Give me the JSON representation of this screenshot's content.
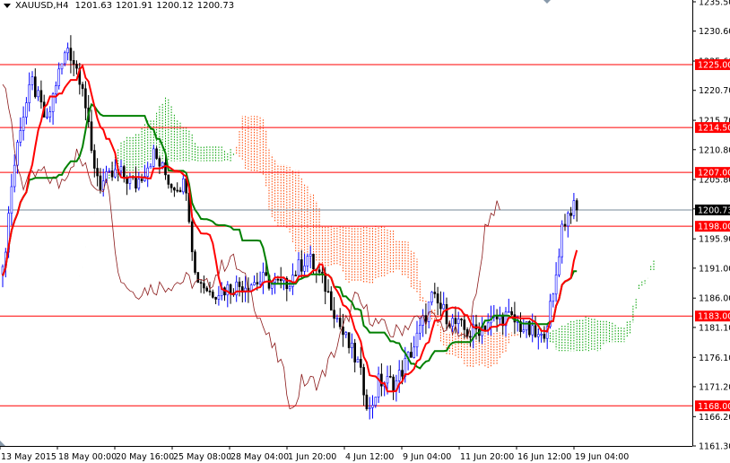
{
  "header": {
    "symbol": "XAUUSD,H4",
    "open": "1201.63",
    "high": "1201.91",
    "low": "1200.12",
    "close": "1200.73"
  },
  "colors": {
    "bull": "#0000ff",
    "bear": "#000000",
    "level": "#ff0000",
    "tenkan": "#ff0000",
    "kijun": "#008000",
    "chikou": "#8b1a1a",
    "cloud_up": "#00a000",
    "cloud_down": "#ff4500",
    "price_line": "#778899"
  },
  "chart_data": {
    "type": "candlestick",
    "symbol": "XAUUSD",
    "timeframe": "H4",
    "ylim": [
      1161.3,
      1235.5
    ],
    "y_ticks": [
      "1235.50",
      "1230.60",
      "1225.60",
      "1220.70",
      "1215.70",
      "1210.80",
      "1205.80",
      "1200.90",
      "1195.90",
      "1191.00",
      "1186.00",
      "1181.10",
      "1176.10",
      "1171.20",
      "1166.20",
      "1161.30"
    ],
    "x_ticks": [
      "13 May 2015",
      "18 May 00:00",
      "20 May 16:00",
      "25 May 08:00",
      "28 May 04:00",
      "1 Jun 20:00",
      "4 Jun 12:00",
      "9 Jun 04:00",
      "11 Jun 20:00",
      "16 Jun 12:00",
      "19 Jun 04:00"
    ],
    "levels": [
      {
        "value": 1225.0,
        "label": "1225.00"
      },
      {
        "value": 1214.5,
        "label": "1214.50"
      },
      {
        "value": 1207.0,
        "label": "1207.00"
      },
      {
        "value": 1198.0,
        "label": "1198.00"
      },
      {
        "value": 1183.0,
        "label": "1183.00"
      },
      {
        "value": 1168.0,
        "label": "1168.00"
      }
    ],
    "current_price": {
      "value": 1200.73,
      "label": "1200.73"
    },
    "indicator": "Ichimoku (9,26,52)",
    "price_path": [
      [
        0,
        1190
      ],
      [
        3,
        1205
      ],
      [
        6,
        1215
      ],
      [
        10,
        1222
      ],
      [
        15,
        1215
      ],
      [
        18,
        1222
      ],
      [
        22,
        1228
      ],
      [
        27,
        1222
      ],
      [
        30,
        1210
      ],
      [
        33,
        1205
      ],
      [
        39,
        1207
      ],
      [
        45,
        1205
      ],
      [
        51,
        1210
      ],
      [
        57,
        1205
      ],
      [
        62,
        1205
      ],
      [
        65,
        1190
      ],
      [
        70,
        1187
      ],
      [
        79,
        1188
      ],
      [
        88,
        1189
      ],
      [
        95,
        1188
      ],
      [
        103,
        1193
      ],
      [
        109,
        1188
      ],
      [
        115,
        1180
      ],
      [
        120,
        1175
      ],
      [
        124,
        1167
      ],
      [
        127,
        1172
      ],
      [
        133,
        1172
      ],
      [
        139,
        1178
      ],
      [
        145,
        1186
      ],
      [
        152,
        1182
      ],
      [
        158,
        1180
      ],
      [
        164,
        1182
      ],
      [
        170,
        1183
      ],
      [
        176,
        1181
      ],
      [
        182,
        1179
      ],
      [
        186,
        1186
      ],
      [
        189,
        1198
      ],
      [
        192,
        1201
      ],
      [
        194,
        1200.73
      ]
    ]
  }
}
